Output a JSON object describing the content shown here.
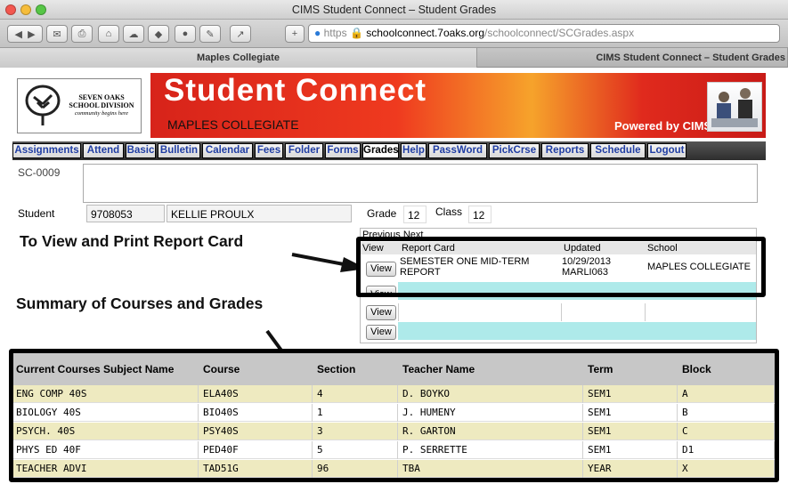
{
  "window": {
    "title": "CIMS Student Connect – Student Grades"
  },
  "address_bar": {
    "protocol": "https",
    "host": "schoolconnect.7oaks.org",
    "path": "/schoolconnect/SCGrades.aspx"
  },
  "tabs": [
    {
      "label": "Maples Collegiate",
      "active": true
    },
    {
      "label": "CIMS Student Connect – Student Grades",
      "active": false
    }
  ],
  "banner": {
    "logo_line1": "SEVEN OAKS",
    "logo_line2": "SCHOOL DIVISION",
    "logo_line3": "community begins here",
    "title": "Student Connect",
    "school": "MAPLES COLLEGIATE",
    "powered": "Powered by CIMS"
  },
  "nav": [
    "Assignments",
    "Attend",
    "Basic",
    "Bulletin",
    "Calendar",
    "Fees",
    "Folder",
    "Forms",
    "Grades",
    "Help",
    "PassWord",
    "PickCrse",
    "Reports",
    "Schedule",
    "Logout"
  ],
  "nav_selected": "Grades",
  "screen_code": "SC-0009",
  "student": {
    "label": "Student",
    "id": "9708053",
    "name": "KELLIE PROULX",
    "grade_label": "Grade",
    "grade": "12",
    "class_label": "Class",
    "class": "12"
  },
  "annotations": {
    "report_card": "To View and Print Report Card",
    "summary": "Summary of Courses and Grades"
  },
  "report_cards": {
    "pager": "Previous Next",
    "headers": [
      "View",
      "Report Card",
      "Updated",
      "School"
    ],
    "view_label": "View",
    "rows": [
      {
        "report": "SEMESTER ONE MID-TERM REPORT",
        "updated": "10/29/2013",
        "updated_by": "MARLI063",
        "school": "MAPLES COLLEGIATE"
      },
      {
        "report": "",
        "updated": "",
        "updated_by": "",
        "school": ""
      },
      {
        "report": "",
        "updated": "",
        "updated_by": "",
        "school": ""
      },
      {
        "report": "",
        "updated": "",
        "updated_by": "",
        "school": ""
      }
    ]
  },
  "courses": {
    "headers": [
      "Current Courses Subject Name",
      "Course",
      "Section",
      "Teacher Name",
      "Term",
      "Block"
    ],
    "rows": [
      [
        "ENG COMP 40S",
        "ELA40S",
        "4",
        "D. BOYKO",
        "SEM1",
        "A"
      ],
      [
        "BIOLOGY 40S",
        "BIO40S",
        "1",
        "J. HUMENY",
        "SEM1",
        "B"
      ],
      [
        "PSYCH. 40S",
        "PSY40S",
        "3",
        "R. GARTON",
        "SEM1",
        "C"
      ],
      [
        "PHYS ED 40F",
        "PED40F",
        "5",
        "P. SERRETTE",
        "SEM1",
        "D1"
      ],
      [
        "TEACHER ADVI",
        "TAD51G",
        "96",
        "TBA",
        "YEAR",
        "X"
      ]
    ]
  },
  "colors": {
    "accent_red": "#d7231a",
    "row_highlight": "#eeeac0",
    "row_cyan": "#aeeaea",
    "link_blue": "#1f3da3"
  }
}
